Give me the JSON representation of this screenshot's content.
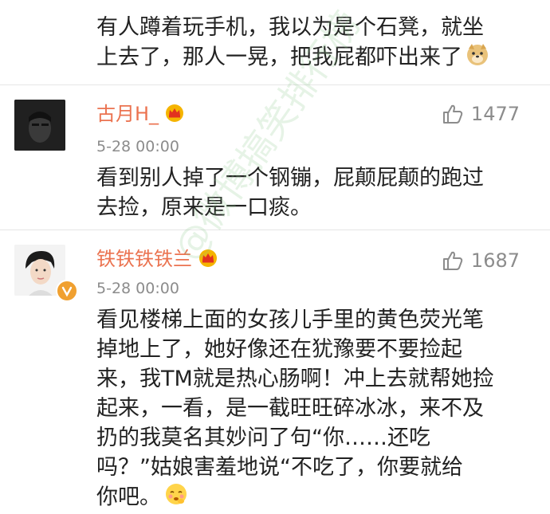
{
  "comments": [
    {
      "text_lines": [
        "有人蹲着玩手机，我以为是个石凳，就坐",
        "上去了，那人一晃，把我屁都吓出来了"
      ],
      "emoji": "doge-emoji"
    },
    {
      "username": "古月H_",
      "time": "5-28 00:00",
      "likes": "1477",
      "text_lines": [
        "看到别人掉了一个钢镚，屁颠屁颠的跑过",
        "去捡，原来是一口痰。"
      ]
    },
    {
      "username": "铁铁铁铁兰",
      "time": "5-28 00:00",
      "likes": "1687",
      "text_lines": [
        "看见楼梯上面的女孩儿手里的黄色荧光笔",
        "掉地上了，她好像还在犹豫要不要捡起",
        "来，我TM就是热心肠啊！冲上去就帮她捡",
        "起来，一看，是一截旺旺碎冰冰，来不及",
        "扔的我莫名其妙问了句“你……还吃",
        "吗？”姑娘害羞地说“不吃了，你要就给",
        "你吧。"
      ],
      "emoji": "shy-emoji"
    }
  ],
  "watermark": "@微博搞笑排行榜",
  "colors": {
    "username": "#eb7350",
    "meta": "#8c8c8c",
    "crown": "#f5b400",
    "verified": "#f0a030"
  }
}
